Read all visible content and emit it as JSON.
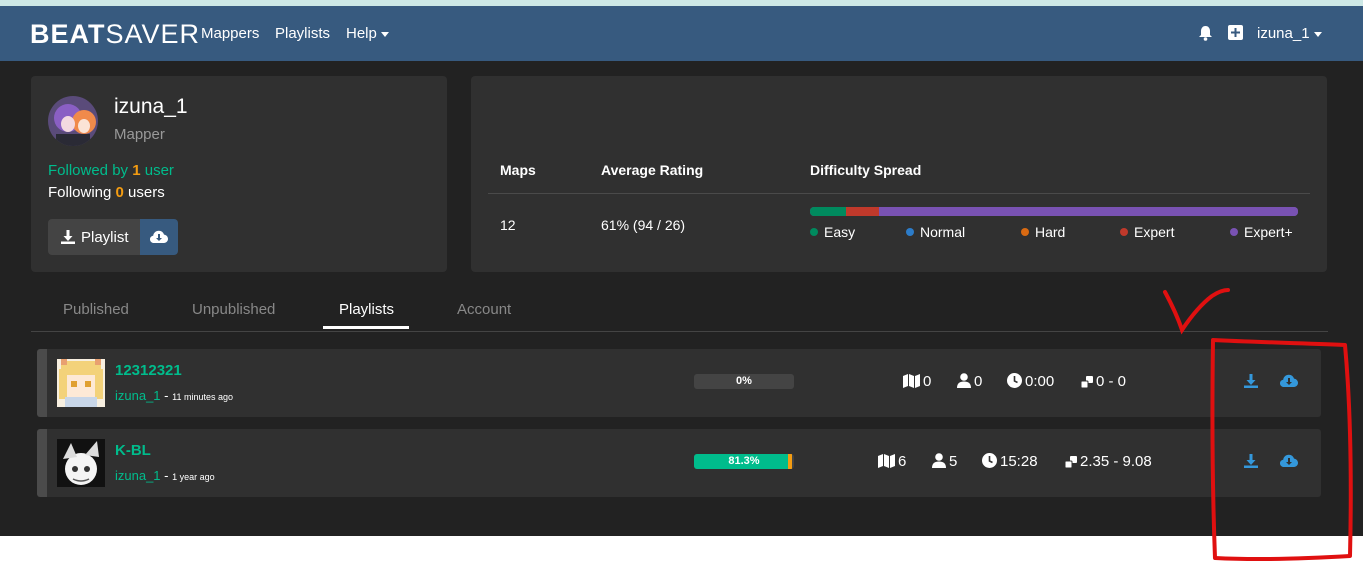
{
  "navbar": {
    "brand_bold": "BEAT",
    "brand_thin": "SAVER",
    "links": [
      "Mappers",
      "Playlists",
      "Help"
    ],
    "user_label": "izuna_1",
    "icons": [
      "bell-icon",
      "plus-square-icon"
    ]
  },
  "profile": {
    "name": "izuna_1",
    "role": "Mapper",
    "followed_prefix": "Followed by ",
    "followed_count": "1",
    "followed_suffix": " user",
    "following_prefix": "Following ",
    "following_count": "0",
    "following_suffix": " users",
    "playlist_button": "Playlist"
  },
  "stats": {
    "maps_label": "Maps",
    "maps_value": "12",
    "rating_label": "Average Rating",
    "rating_value": "61% (94 / 26)",
    "spread_label": "Difficulty Spread",
    "difficulty_spread": [
      {
        "name": "Easy",
        "fraction": 0.073,
        "color": "#008a5e"
      },
      {
        "name": "Normal",
        "fraction": 0.0,
        "color": "#2c7cc9"
      },
      {
        "name": "Hard",
        "fraction": 0.0,
        "color": "#d96a12"
      },
      {
        "name": "Expert",
        "fraction": 0.068,
        "color": "#c0392b"
      },
      {
        "name": "Expert+",
        "fraction": 0.859,
        "color": "#7952b3"
      }
    ]
  },
  "tabs": [
    "Published",
    "Unpublished",
    "Playlists",
    "Account"
  ],
  "active_tab": "Playlists",
  "playlists": [
    {
      "title": "12312321",
      "author": "izuna_1",
      "sep": " - ",
      "time": "11 minutes ago",
      "progress_label": "0%",
      "progress": 0.0,
      "maps": "0",
      "mappers": "0",
      "duration": "0:00",
      "nps_range": "0 - 0"
    },
    {
      "title": "K-BL",
      "author": "izuna_1",
      "sep": " - ",
      "time": "1 year ago",
      "progress_label": "81.3%",
      "progress": 0.938,
      "maps": "6",
      "mappers": "5",
      "duration": "15:28",
      "nps_range": "2.35 - 9.08"
    }
  ]
}
